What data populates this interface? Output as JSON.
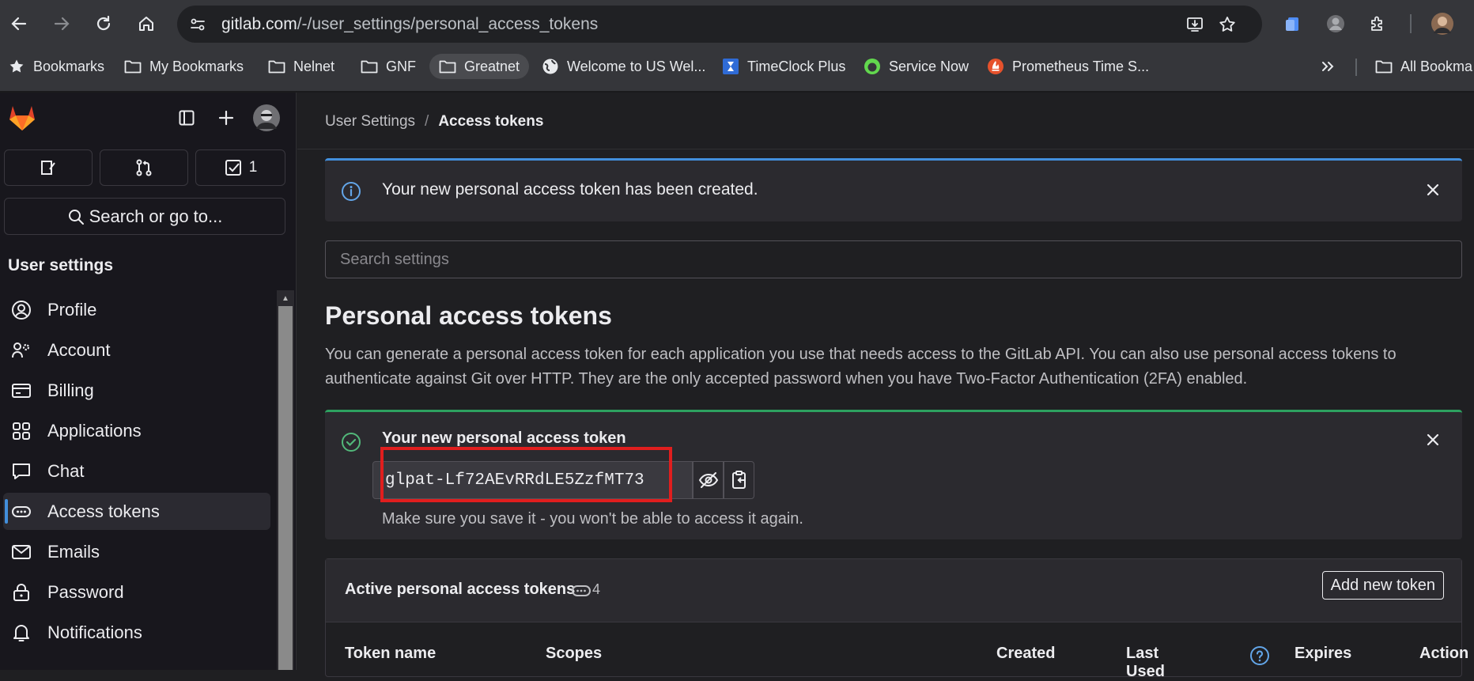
{
  "browser": {
    "url_domain": "gitlab.com",
    "url_path": "/-/user_settings/personal_access_tokens",
    "bookmarks": [
      {
        "label": "Bookmarks",
        "icon": "star-icon"
      },
      {
        "label": "My Bookmarks",
        "icon": "folder-icon"
      },
      {
        "label": "Nelnet",
        "icon": "folder-icon"
      },
      {
        "label": "GNF",
        "icon": "folder-icon"
      },
      {
        "label": "Greatnet",
        "icon": "folder-icon"
      },
      {
        "label": "Welcome to US Wel...",
        "icon": "globe-icon"
      },
      {
        "label": "TimeClock Plus",
        "icon": "hourglass-icon"
      },
      {
        "label": "Service Now",
        "icon": "servicenow-icon"
      },
      {
        "label": "Prometheus Time S...",
        "icon": "prometheus-icon"
      },
      {
        "label": "All Bookma",
        "icon": "folder-icon"
      }
    ]
  },
  "sidebar": {
    "todo_count": "1",
    "search_label": "Search or go to...",
    "section_title": "User settings",
    "items": [
      {
        "label": "Profile",
        "icon": "profile-icon"
      },
      {
        "label": "Account",
        "icon": "account-icon"
      },
      {
        "label": "Billing",
        "icon": "billing-icon"
      },
      {
        "label": "Applications",
        "icon": "applications-icon"
      },
      {
        "label": "Chat",
        "icon": "chat-icon"
      },
      {
        "label": "Access tokens",
        "icon": "token-icon"
      },
      {
        "label": "Emails",
        "icon": "mail-icon"
      },
      {
        "label": "Password",
        "icon": "lock-icon"
      },
      {
        "label": "Notifications",
        "icon": "bell-icon"
      }
    ]
  },
  "breadcrumb": {
    "parent": "User Settings",
    "current": "Access tokens"
  },
  "info_alert": {
    "message": "Your new personal access token has been created."
  },
  "search": {
    "placeholder": "Search settings"
  },
  "page": {
    "title": "Personal access tokens",
    "description": "You can generate a personal access token for each application you use that needs access to the GitLab API. You can also use personal access tokens to authenticate against Git over HTTP. They are the only accepted password when you have Two-Factor Authentication (2FA) enabled."
  },
  "new_token": {
    "title": "Your new personal access token",
    "value": "glpat-Lf72AEvRRdLE5ZzfMT73",
    "note": "Make sure you save it - you won't be able to access it again."
  },
  "active_tokens": {
    "title": "Active personal access tokens",
    "count": "4",
    "add_button": "Add new token",
    "columns": {
      "name": "Token name",
      "scopes": "Scopes",
      "created": "Created",
      "last_used_1": "Last",
      "last_used_2": "Used",
      "expires": "Expires",
      "action": "Action"
    }
  },
  "colors": {
    "accent": "#428fdc",
    "success": "#2da160",
    "highlight": "#e01e1e"
  }
}
